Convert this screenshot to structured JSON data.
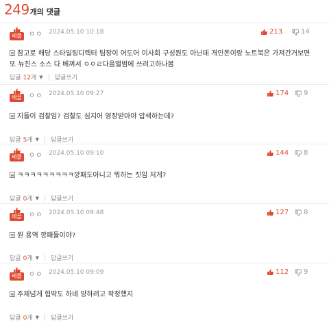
{
  "header": {
    "count": "249",
    "label": "개의 댓글"
  },
  "badge_label": "베플",
  "reply_label": "답글",
  "reply_unit": "개",
  "write_reply_label": "답글쓰기",
  "comments": [
    {
      "author": "ㅇㅇ",
      "date": "2024.05.10 10:18",
      "up": "213",
      "down": "14",
      "lines": [
        "참고로 해당 스타일링디렉터 팀장이 어도어 이사회 구성원도 아닌데 개인폰이랑 노트북은 가져간거보면",
        "또 뉴진스 소스 다 베껴서 ㅇㅇㄹ다음앨범에 쓰려고하나봄"
      ],
      "replies": "12"
    },
    {
      "author": "ㅇㅇ",
      "date": "2024.05.10 09:27",
      "up": "174",
      "down": "9",
      "lines": [
        "지들이 검찰임? 검찰도 심지어 영장받아야 압색하는데?"
      ],
      "replies": "5"
    },
    {
      "author": "ㅇㅇ",
      "date": "2024.05.10 09:10",
      "up": "144",
      "down": "8",
      "lines": [
        "ㅋㅋㅋㅋㅋㅋㅋㅋㅋ깡패도아니고 뭐하는 짓임 저게?"
      ],
      "replies": "0"
    },
    {
      "author": "ㅇㅇ",
      "date": "2024.05.10 09:48",
      "up": "127",
      "down": "8",
      "lines": [
        "뭔 용역 깡패들이야?"
      ],
      "replies": "0"
    },
    {
      "author": "ㅇㅇ",
      "date": "2024.05.10 09:09",
      "up": "112",
      "down": "9",
      "lines": [
        "주제넘게 협박도 하네 망하려고 작정했지"
      ],
      "replies": "0"
    }
  ]
}
